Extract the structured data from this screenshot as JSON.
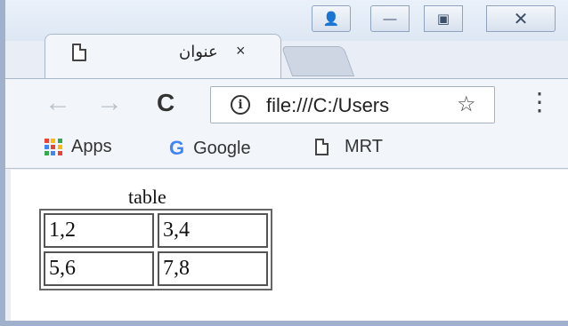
{
  "tabs": [
    {
      "title": "عنوان",
      "close": "×"
    }
  ],
  "toolbar": {
    "url": "file:///C:/Users",
    "back": "←",
    "forward": "→",
    "reload": "C",
    "info": "i",
    "star": "☆",
    "menu": "⋮"
  },
  "window_controls": {
    "profile": "👤",
    "minimize": "—",
    "maximize": "▣",
    "close": "✕"
  },
  "bookmarks": [
    {
      "label": "Apps",
      "icon": "apps-grid-icon"
    },
    {
      "label": "Google",
      "icon": "google-icon",
      "icon_text": "G"
    },
    {
      "label": "MRT",
      "icon": "page-icon"
    }
  ],
  "page": {
    "caption": "table",
    "rows": [
      [
        "1,2",
        "3,4"
      ],
      [
        "5,6",
        "7,8"
      ]
    ]
  },
  "colors": {
    "apps_dots": [
      "#ea4335",
      "#fbbc05",
      "#34a853",
      "#4285f4",
      "#ea4335",
      "#fbbc05",
      "#34a853",
      "#4285f4",
      "#ea4335"
    ]
  }
}
